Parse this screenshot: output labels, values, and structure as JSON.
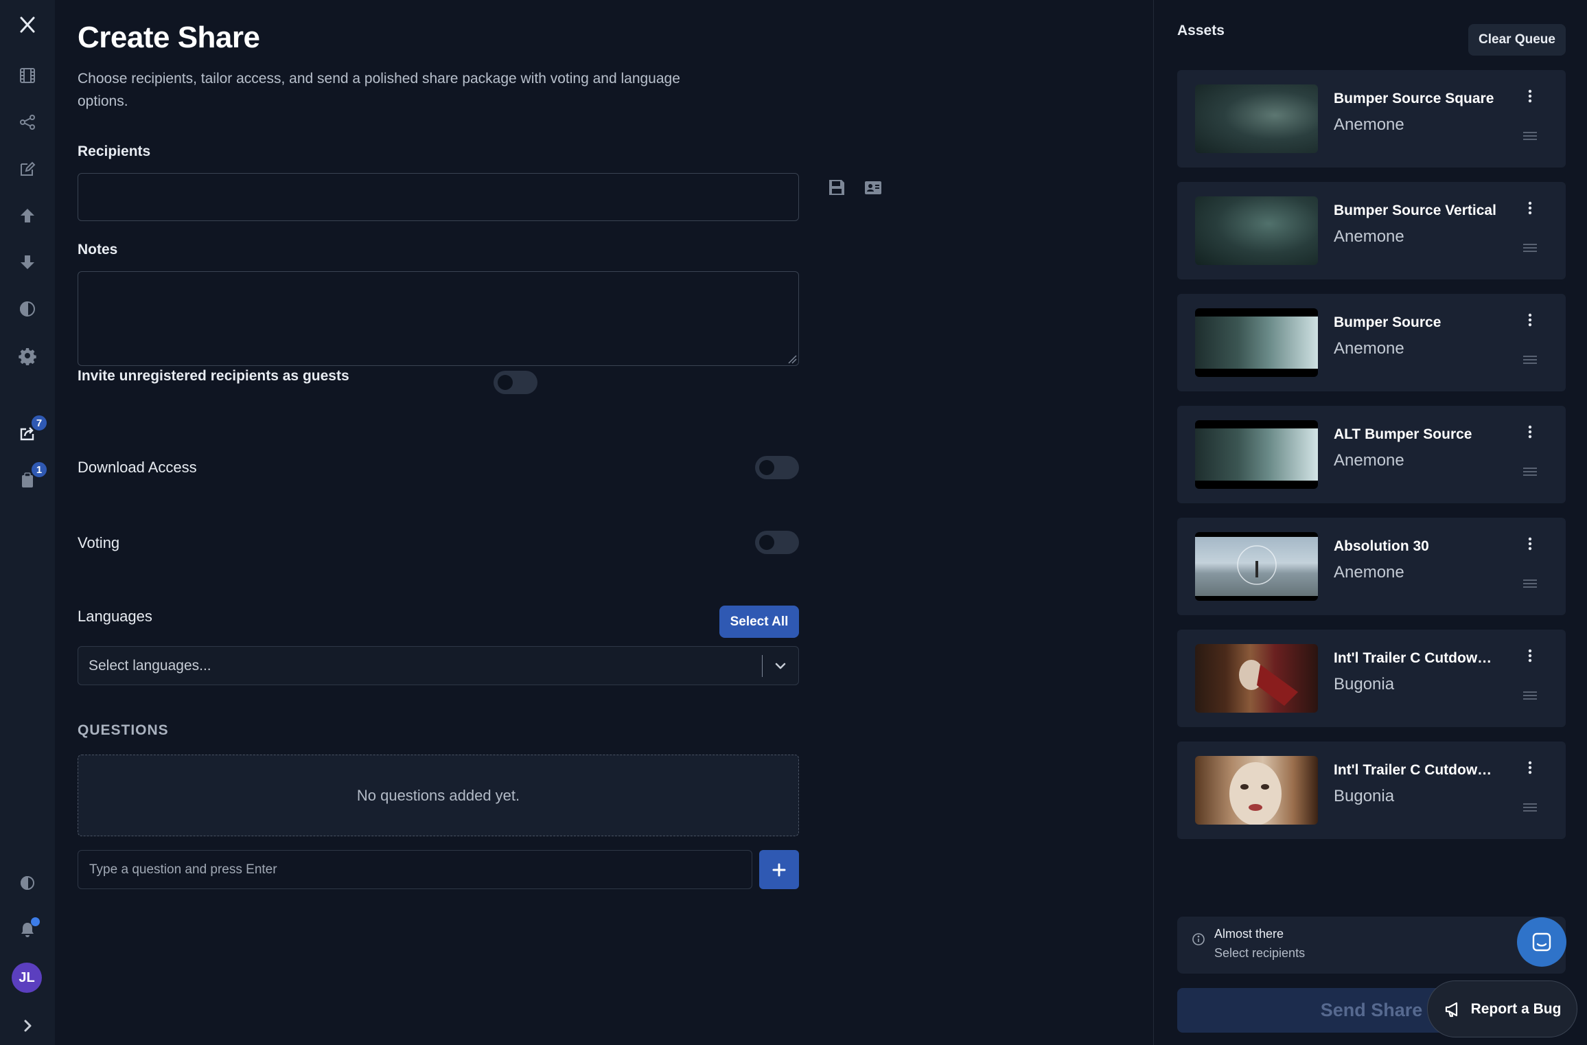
{
  "nav": {
    "badges": {
      "shares": "7",
      "queue": "1"
    },
    "avatar_initials": "JL"
  },
  "page": {
    "title": "Create Share",
    "subtitle": "Choose recipients, tailor access, and send a polished share package with voting and language options."
  },
  "form": {
    "recipients_label": "Recipients",
    "recipients_value": "",
    "notes_label": "Notes",
    "notes_value": "",
    "invite_guests_label": "Invite unregistered recipients as guests",
    "download_access_label": "Download Access",
    "voting_label": "Voting",
    "toggles": {
      "invite_guests": false,
      "download_access": false,
      "voting": false
    },
    "languages_label": "Languages",
    "select_all_label": "Select All",
    "languages_placeholder": "Select languages...",
    "questions_heading": "QUESTIONS",
    "questions_empty": "No questions added yet.",
    "question_placeholder": "Type a question and press Enter"
  },
  "assets": {
    "title": "Assets",
    "clear_queue_label": "Clear Queue",
    "items": [
      {
        "title": "Bumper Source Square",
        "project": "Anemone"
      },
      {
        "title": "Bumper Source Vertical",
        "project": "Anemone"
      },
      {
        "title": "Bumper Source",
        "project": "Anemone"
      },
      {
        "title": "ALT Bumper Source",
        "project": "Anemone"
      },
      {
        "title": "Absolution 30",
        "project": "Anemone"
      },
      {
        "title": "Int'l Trailer C Cutdown",
        "project": "Bugonia"
      },
      {
        "title": "Int'l Trailer C Cutdown",
        "project": "Bugonia"
      }
    ],
    "status_title": "Almost there",
    "status_sub": "Select recipients",
    "send_label": "Send Share"
  },
  "report_bug_label": "Report a Bug",
  "colors": {
    "background": "#0f1522",
    "rail": "#151d2b",
    "accent": "#2f59b3",
    "card": "#1a2232"
  }
}
